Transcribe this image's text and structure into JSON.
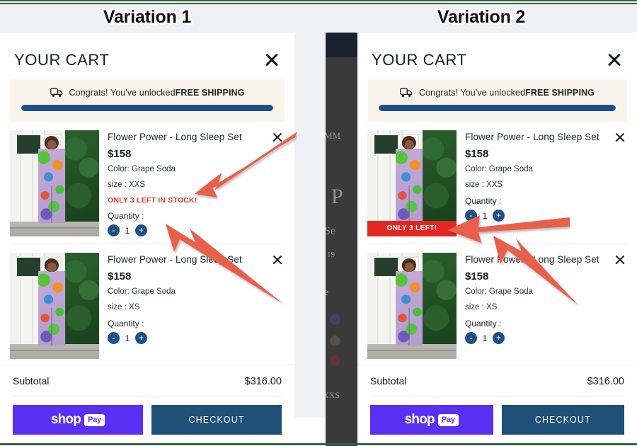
{
  "page": {
    "variation1_title": "Variation 1",
    "variation2_title": "Variation 2"
  },
  "colors": {
    "frame_green": "#35613f",
    "page_bg": "#f0f1f5",
    "progress_blue": "#1f5088",
    "banner_cream": "#faf5ec",
    "stock_red_text": "#e8312b",
    "stock_badge_red": "#e52522",
    "shop_pay_purple": "#5a31f4",
    "checkout_blue": "#1f5078",
    "arrow_coral": "#e8604c",
    "qty_button_blue": "#1f5088"
  },
  "cart": {
    "title": "YOUR CART",
    "close_label": "close-cart",
    "shipping": {
      "message_prefix": "Congrats! You've unlocked",
      "message_bold": "FREE SHIPPING",
      "progress_percent": 100,
      "icon": "delivery-truck-icon"
    },
    "footer": {
      "subtotal_label": "Subtotal",
      "subtotal_value": "$316.00",
      "shop_pay_word": "shop",
      "shop_pay_pill": "Pay",
      "checkout_label": "CHECKOUT"
    }
  },
  "variation1": {
    "items": [
      {
        "name": "Flower Power - Long Sleep Set",
        "price": "$158",
        "color": "Color: Grape Soda",
        "size": "size : XXS",
        "stock_message": "ONLY 3 LEFT IN STOCK!",
        "qty_label": "Quantity :",
        "qty_value": "1",
        "minus": "-",
        "plus": "+"
      },
      {
        "name": "Flower Power - Long Sleep Set",
        "price": "$158",
        "color": "Color: Grape Soda",
        "size": "size : XS",
        "stock_message": "",
        "qty_label": "Quantity :",
        "qty_value": "1",
        "minus": "-",
        "plus": "+"
      }
    ]
  },
  "variation2": {
    "items": [
      {
        "name": "Flower Power - Long Sleep Set",
        "price": "$158",
        "color": "Color: Grape Soda",
        "size": "size : XXS",
        "badge_message": "ONLY 3 LEFT!",
        "qty_label": "Quantity :",
        "qty_value": "1",
        "minus": "-",
        "plus": "+"
      },
      {
        "name": "Flower Power - Long Sleep Set",
        "price": "$158",
        "color": "Color: Grape Soda",
        "size": "size : XS",
        "badge_message": "",
        "qty_label": "Quantity :",
        "qty_value": "1",
        "minus": "-",
        "plus": "+"
      }
    ],
    "background_fragments": [
      "MM",
      "P",
      "Se",
      "19",
      "e",
      "XXS"
    ]
  },
  "annotations": {
    "arrow_1_target": "only-3-left-in-stock-text",
    "arrow_2_target": "quantity-label",
    "arrow_3_target": "only-3-left-badge",
    "arrow_4_target": "second-item-area"
  }
}
